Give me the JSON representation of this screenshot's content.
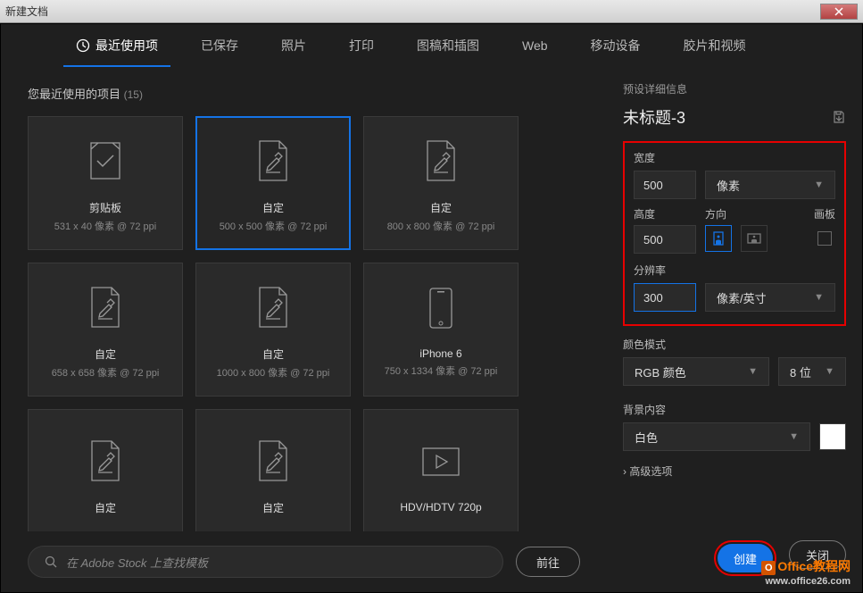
{
  "title": "新建文档",
  "tabs": [
    "最近使用项",
    "已保存",
    "照片",
    "打印",
    "图稿和插图",
    "Web",
    "移动设备",
    "胶片和视频"
  ],
  "active_tab": 0,
  "recent": {
    "label": "您最近使用的项目",
    "count": "(15)"
  },
  "cards": [
    {
      "title": "剪贴板",
      "dims": "531 x 40 像素 @ 72 ppi",
      "icon": "clipboard",
      "selected": false
    },
    {
      "title": "自定",
      "dims": "500 x 500 像素 @ 72 ppi",
      "icon": "custom",
      "selected": true
    },
    {
      "title": "自定",
      "dims": "800 x 800 像素 @ 72 ppi",
      "icon": "custom",
      "selected": false
    },
    {
      "title": "自定",
      "dims": "658 x 658 像素 @ 72 ppi",
      "icon": "custom",
      "selected": false
    },
    {
      "title": "自定",
      "dims": "1000 x 800 像素 @ 72 ppi",
      "icon": "custom",
      "selected": false
    },
    {
      "title": "iPhone 6",
      "dims": "750 x 1334 像素 @ 72 ppi",
      "icon": "phone",
      "selected": false
    },
    {
      "title": "自定",
      "dims": "",
      "icon": "custom",
      "selected": false
    },
    {
      "title": "自定",
      "dims": "",
      "icon": "custom",
      "selected": false
    },
    {
      "title": "HDV/HDTV 720p",
      "dims": "",
      "icon": "video",
      "selected": false
    }
  ],
  "search": {
    "placeholder": "在 Adobe Stock 上查找模板",
    "go": "前往"
  },
  "details": {
    "header": "预设详细信息",
    "doc_name": "未标题-3",
    "width_label": "宽度",
    "width_value": "500",
    "width_unit": "像素",
    "height_label": "高度",
    "height_value": "500",
    "orient_label": "方向",
    "artboard_label": "画板",
    "res_label": "分辨率",
    "res_value": "300",
    "res_unit": "像素/英寸",
    "color_label": "颜色模式",
    "color_value": "RGB 颜色",
    "bit_value": "8 位",
    "bg_label": "背景内容",
    "bg_value": "白色",
    "adv": "高级选项"
  },
  "buttons": {
    "create": "创建",
    "close": "关闭"
  },
  "watermark": {
    "brand": "Office教程网",
    "url": "www.office26.com"
  }
}
